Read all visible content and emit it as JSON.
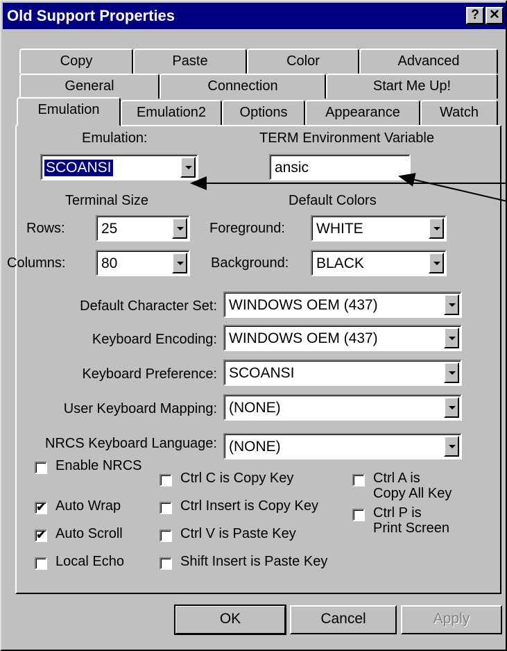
{
  "window": {
    "title": "Old Support Properties",
    "help_button": "?",
    "close_button": "✕"
  },
  "tabs": {
    "row1": [
      "Copy",
      "Paste",
      "Color",
      "Advanced"
    ],
    "row2": [
      "General",
      "Connection",
      "Start Me Up!"
    ],
    "row3": [
      "Emulation",
      "Emulation2",
      "Options",
      "Appearance",
      "Watch"
    ],
    "active": "Emulation"
  },
  "emulation": {
    "label": "Emulation:",
    "value": "SCOANSI"
  },
  "term_env": {
    "label": "TERM Environment Variable",
    "value": "ansic"
  },
  "terminal_size": {
    "heading": "Terminal Size",
    "rows_label": "Rows:",
    "rows_value": "25",
    "columns_label": "Columns:",
    "columns_value": "80"
  },
  "default_colors": {
    "heading": "Default Colors",
    "fg_label": "Foreground:",
    "fg_value": "WHITE",
    "bg_label": "Background:",
    "bg_value": "BLACK"
  },
  "settings": [
    {
      "label": "Default Character Set:",
      "value": "WINDOWS OEM (437)"
    },
    {
      "label": "Keyboard Encoding:",
      "value": "WINDOWS OEM (437)"
    },
    {
      "label": "Keyboard Preference:",
      "value": "SCOANSI"
    },
    {
      "label": "User Keyboard Mapping:",
      "value": "(NONE)"
    },
    {
      "label": "NRCS Keyboard Language:",
      "value": "(NONE)"
    }
  ],
  "checkboxes": {
    "enable_nrcs": {
      "label": "Enable NRCS",
      "checked": false
    },
    "auto_wrap": {
      "label": "Auto Wrap",
      "checked": true
    },
    "auto_scroll": {
      "label": "Auto Scroll",
      "checked": true
    },
    "local_echo": {
      "label": "Local Echo",
      "checked": false
    },
    "ctrl_c": {
      "label": "Ctrl C is Copy Key",
      "checked": false
    },
    "ctrl_insert": {
      "label": "Ctrl Insert is Copy Key",
      "checked": false
    },
    "ctrl_v": {
      "label": "Ctrl V is Paste Key",
      "checked": false
    },
    "shift_insert": {
      "label": "Shift Insert is Paste Key",
      "checked": false
    },
    "ctrl_a": {
      "label_line1": "Ctrl A is",
      "label_line2": "Copy All Key",
      "checked": false
    },
    "ctrl_p": {
      "label_line1": "Ctrl P is",
      "label_line2": "Print Screen",
      "checked": false
    }
  },
  "buttons": {
    "ok": "OK",
    "cancel": "Cancel",
    "apply": "Apply"
  },
  "check_mark": "✔",
  "colors": {
    "title_bar": "#000080",
    "face": "#c0c0c0",
    "selection": "#000080"
  }
}
